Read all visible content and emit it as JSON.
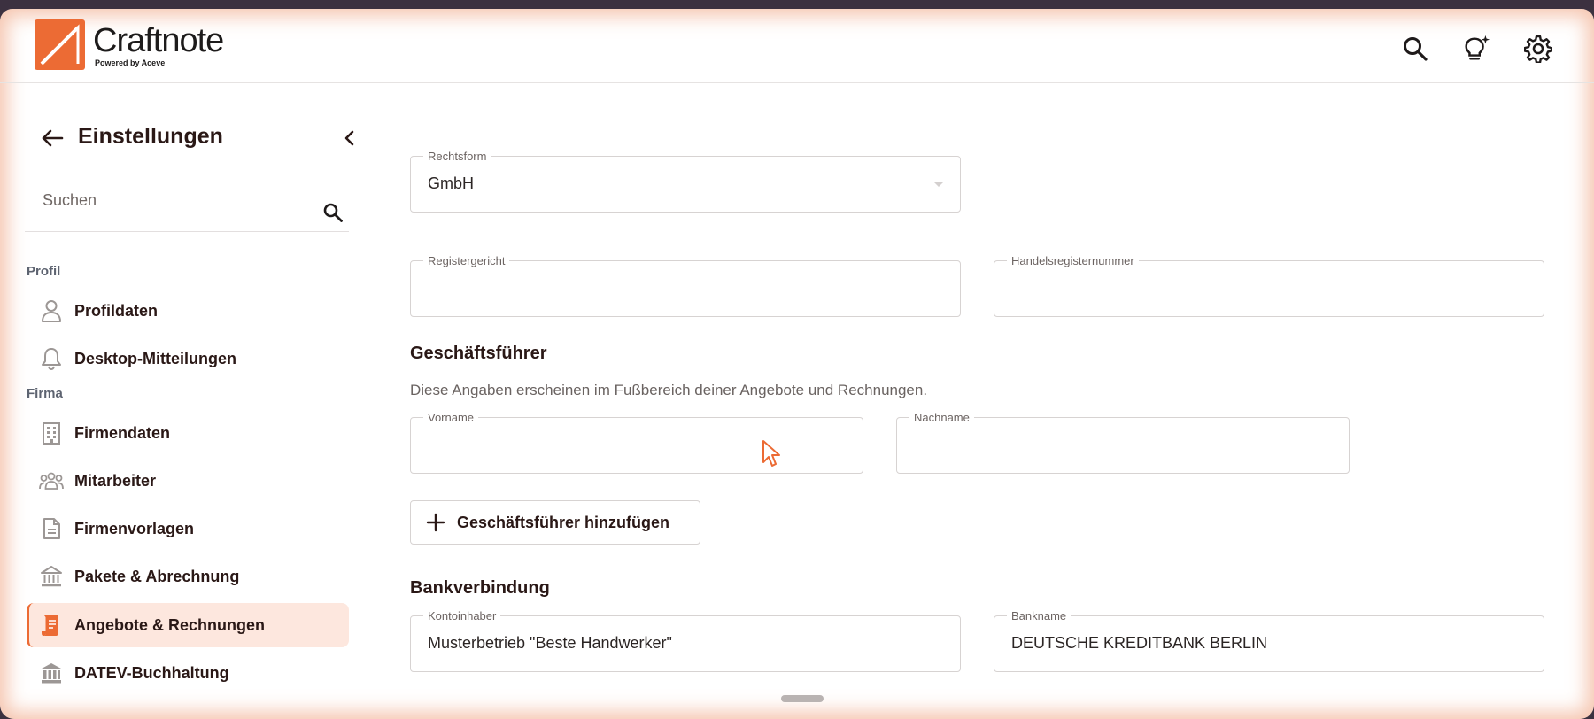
{
  "app": {
    "name": "Craftnote",
    "tagline": "Powered by Aceve",
    "accent": "#ec6b34"
  },
  "header": {
    "icons": [
      "search-icon",
      "lightbulb-sparkle-icon",
      "gear-icon"
    ]
  },
  "sidebar": {
    "title": "Einstellungen",
    "search_placeholder": "Suchen",
    "sections": [
      {
        "label": "Profil",
        "items": [
          {
            "label": "Profildaten",
            "icon": "person-icon"
          },
          {
            "label": "Desktop-Mitteilungen",
            "icon": "bell-icon"
          }
        ]
      },
      {
        "label": "Firma",
        "items": [
          {
            "label": "Firmendaten",
            "icon": "building-icon"
          },
          {
            "label": "Mitarbeiter",
            "icon": "team-icon"
          },
          {
            "label": "Firmenvorlagen",
            "icon": "document-icon"
          },
          {
            "label": "Pakete & Abrechnung",
            "icon": "bank-icon"
          },
          {
            "label": "Angebote & Rechnungen",
            "icon": "invoice-icon",
            "active": true
          },
          {
            "label": "DATEV-Buchhaltung",
            "icon": "institution-icon"
          }
        ]
      }
    ]
  },
  "main": {
    "rechtsform": {
      "label": "Rechtsform",
      "value": "GmbH"
    },
    "registergericht": {
      "label": "Registergericht",
      "value": ""
    },
    "handelsregisternummer": {
      "label": "Handelsregisternummer",
      "value": ""
    },
    "geschaeftsfuehrer": {
      "heading": "Geschäftsführer",
      "description": "Diese Angaben erscheinen im Fußbereich deiner Angebote und Rechnungen.",
      "vorname": {
        "label": "Vorname",
        "value": ""
      },
      "nachname": {
        "label": "Nachname",
        "value": ""
      },
      "add_button": "Geschäftsführer hinzufügen"
    },
    "bank": {
      "heading": "Bankverbindung",
      "kontoinhaber": {
        "label": "Kontoinhaber",
        "value": "Musterbetrieb \"Beste Handwerker\""
      },
      "bankname": {
        "label": "Bankname",
        "value": "DEUTSCHE KREDITBANK BERLIN"
      }
    }
  }
}
